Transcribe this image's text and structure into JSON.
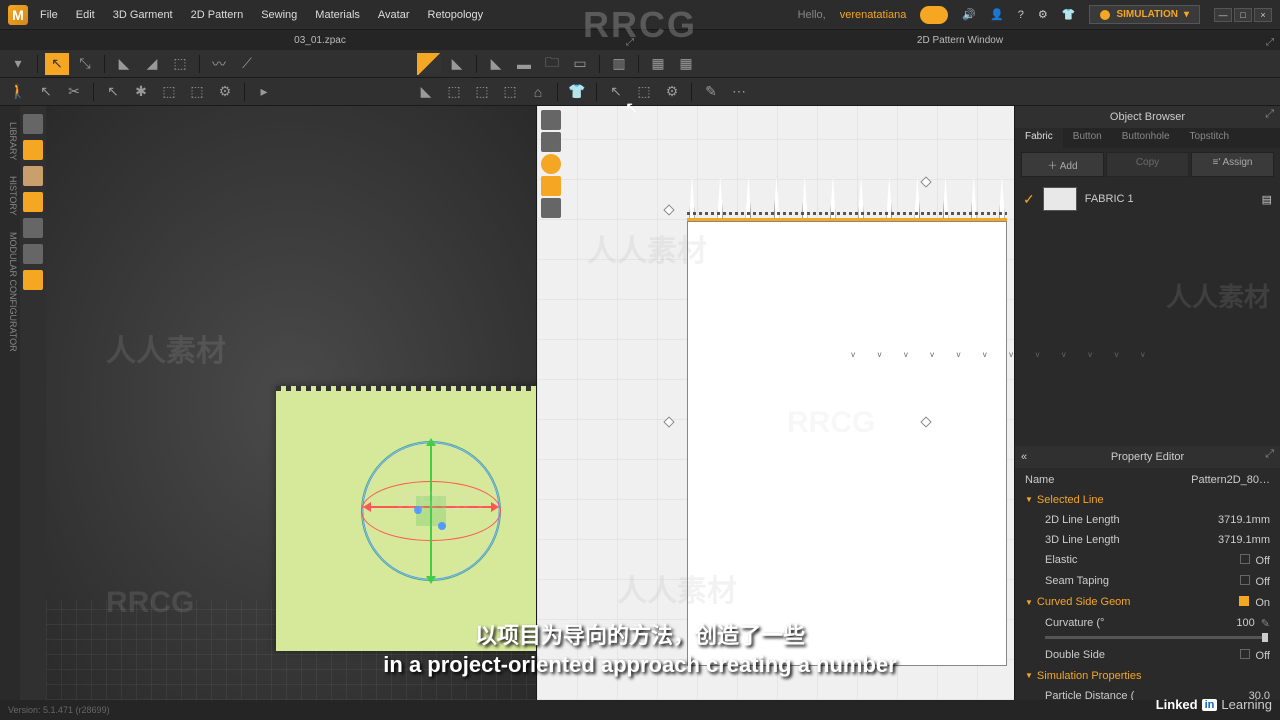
{
  "app_logo_letter": "M",
  "menu": [
    "File",
    "Edit",
    "3D Garment",
    "2D Pattern",
    "Sewing",
    "Materials",
    "Avatar",
    "Retopology"
  ],
  "hello": "Hello,",
  "username": "verenatatiana",
  "sim_button": "SIMULATION",
  "window_tabs": {
    "left": "03_01.zpac",
    "right": "2D Pattern Window"
  },
  "object_browser": {
    "title": "Object Browser",
    "tabs": [
      "Fabric",
      "Button",
      "Buttonhole",
      "Topstitch"
    ],
    "buttons": {
      "add": "＋ Add",
      "copy": "Copy",
      "assign": "≡' Assign"
    },
    "items": [
      {
        "name": "FABRIC 1"
      }
    ]
  },
  "property_editor": {
    "title": "Property Editor",
    "name_label": "Name",
    "name_value": "Pattern2D_80…",
    "sections": {
      "selected_line": "Selected Line",
      "curved_side": "Curved Side Geom",
      "sim_props": "Simulation Properties"
    },
    "rows": {
      "line2d_label": "2D Line Length",
      "line2d_value": "3719.1mm",
      "line3d_label": "3D Line Length",
      "line3d_value": "3719.1mm",
      "elastic_label": "Elastic",
      "elastic_value": "Off",
      "seam_label": "Seam Taping",
      "seam_value": "Off",
      "curved_value": "On",
      "curvature_label": "Curvature (°",
      "curvature_value": "100",
      "double_label": "Double Side",
      "double_value": "Off",
      "particle_label": "Particle Distance (",
      "particle_value": "30.0"
    }
  },
  "status": "Version: 5.1.471 (r28699)",
  "subtitle_cn": "以项目为导向的方法，创造了一些",
  "subtitle_en": "in a project-oriented approach creating a number",
  "linkedin": {
    "brand": "Linked",
    "in": "in",
    "learning": "Learning"
  },
  "watermark_brand": "RRCG",
  "watermark_cn": "人人素材"
}
